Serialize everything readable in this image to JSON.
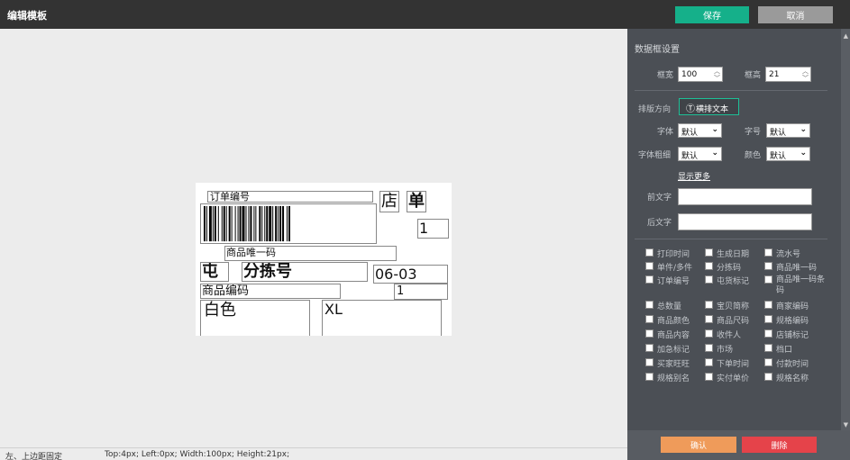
{
  "header": {
    "title": "编辑模板",
    "save_label": "保存",
    "cancel_label": "取消"
  },
  "label": {
    "order_no": "订单编号",
    "shop": "店",
    "single": "单",
    "qty": "1",
    "product_unique_code": "商品唯一码",
    "tun": "屯",
    "sort_no": "分拣号",
    "sort_value": "06-03",
    "product_code": "商品编码",
    "count": "1",
    "color": "白色",
    "size": "XL"
  },
  "panel": {
    "section_title": "数据框设置",
    "width_label": "框宽",
    "width_value": "100",
    "height_label": "框高",
    "height_value": "21",
    "direction_label": "排版方向",
    "direction_button": "横排文本",
    "direction_icon": "text-horizontal-icon",
    "font_label": "字体",
    "font_value": "默认",
    "size_label": "字号",
    "size_value": "默认",
    "weight_label": "字体粗细",
    "weight_value": "默认",
    "color_label": "颜色",
    "color_value": "默认",
    "show_more": "显示更多",
    "prefix_label": "前文字",
    "suffix_label": "后文字",
    "checkboxes": [
      "打印时间",
      "生成日期",
      "流水号",
      "单件/多件",
      "分拣码",
      "商品唯一码",
      "订单编号",
      "屯货标记",
      "商品唯一码条码",
      "总数量",
      "宝贝简称",
      "商家编码",
      "商品颜色",
      "商品尺码",
      "规格编码",
      "商品内容",
      "收件人",
      "店铺标记",
      "加急标记",
      "市场",
      "档口",
      "买家旺旺",
      "下单时间",
      "付款时间",
      "规格别名",
      "实付单价",
      "规格名称"
    ],
    "confirm_label": "确认",
    "delete_label": "删除"
  },
  "status": {
    "text": "左、上边距固定",
    "geometry": "Top:4px;  Left:0px;  Width:100px;  Height:21px;"
  },
  "colors": {
    "accent": "#15b08a",
    "confirm": "#ef9b5a",
    "delete": "#e5434a",
    "panel": "#4b4f55",
    "topbar": "#333333"
  }
}
